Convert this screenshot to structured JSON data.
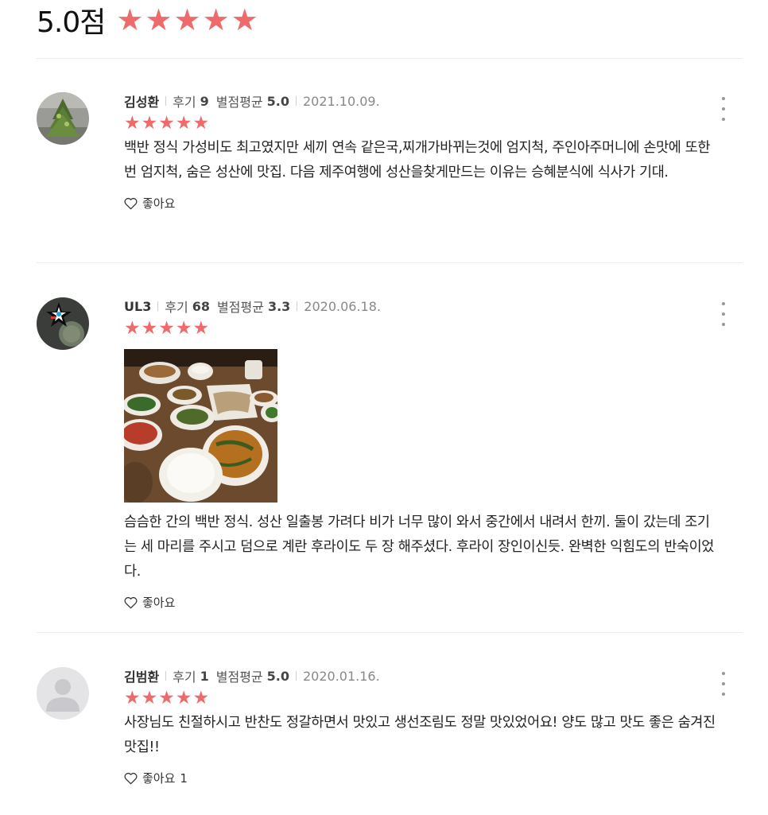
{
  "summary": {
    "score": "5.0점",
    "star_count": 5
  },
  "like_icon": "heart-outline-icon",
  "more_icon": "kebab-menu-icon",
  "star_color": "#ef6b6b",
  "reviews": [
    {
      "author": "김성환",
      "review_label": "후기",
      "review_count": "9",
      "avg_label": "별점평균",
      "avg_score": "5.0",
      "date": "2021.10.09.",
      "rating": 5,
      "text": "백반 정식 가성비도 최고였지만 세끼 연속 같은국,찌개가바뀌는것에 엄지척, 주인아주머니에 손맛에 또한번 엄지척, 숨은 성산에 맛집. 다음 제주여행에 성산을찾게만드는 이유는 승혜분식에 식사가 기대.",
      "like_label": "좋아요",
      "like_count": ""
    },
    {
      "author": "UL3",
      "review_label": "후기",
      "review_count": "68",
      "avg_label": "별점평균",
      "avg_score": "3.3",
      "date": "2020.06.18.",
      "rating": 5,
      "text": "슴슴한 간의 백반 정식.  성산 일출봉 가려다 비가 너무 많이 와서 중간에서 내려서 한끼.  둘이 갔는데 조기는 세 마리를 주시고 덤으로 계란 후라이도 두 장 해주셨다.  후라이 장인이신듯. 완벽한 익힘도의 반숙이었다.",
      "like_label": "좋아요",
      "like_count": ""
    },
    {
      "author": "김범환",
      "review_label": "후기",
      "review_count": "1",
      "avg_label": "별점평균",
      "avg_score": "5.0",
      "date": "2020.01.16.",
      "rating": 5,
      "text": "사장님도 친절하시고 반찬도 정갈하면서 맛있고 생선조림도 정말 맛있었어요! 양도 많고 맛도 좋은 숨겨진 맛집!!",
      "like_label": "좋아요",
      "like_count": "1"
    }
  ]
}
